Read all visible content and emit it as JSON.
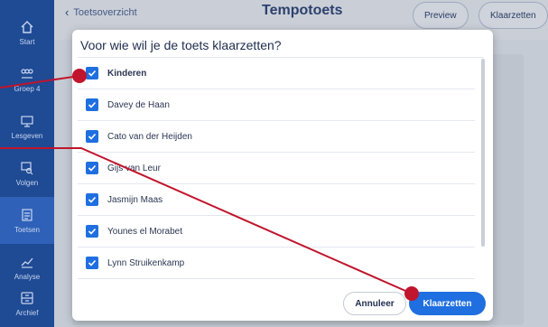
{
  "sidebar": {
    "items": [
      {
        "label": "Start",
        "icon": "home-icon"
      },
      {
        "label": "Groep 4",
        "icon": "group-icon"
      },
      {
        "label": "Lesgeven",
        "icon": "presentation-icon"
      },
      {
        "label": "Volgen",
        "icon": "monitor-search-icon"
      },
      {
        "label": "Toetsen",
        "icon": "test-list-icon"
      },
      {
        "label": "Analyse",
        "icon": "chart-icon"
      },
      {
        "label": "Archief",
        "icon": "archive-icon"
      }
    ],
    "active_index": 4
  },
  "topbar": {
    "back_label": "Toetsoverzicht",
    "title": "Tempotoets",
    "preview_label": "Preview",
    "klaarzetten_label": "Klaarzetten"
  },
  "dialog": {
    "title": "Voor wie wil je de toets klaarzetten?",
    "header_row": "Kinderen",
    "students": [
      "Davey de Haan",
      "Cato van der Heijden",
      "Gijs van Leur",
      "Jasmijn Maas",
      "Younes el Morabet",
      "Lynn Struikenkamp"
    ],
    "cancel_label": "Annuleer",
    "confirm_label": "Klaarzetten"
  },
  "colors": {
    "sidebar": "#1f4a94",
    "sidebar_active": "#2f61b8",
    "accent": "#1f6fe0",
    "annotation": "#c0152c"
  }
}
